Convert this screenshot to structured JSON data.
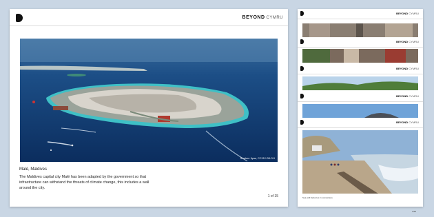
{
  "brand": {
    "name": "BEYOND",
    "region": "CYMRU"
  },
  "main": {
    "photo_credit": "Shahee Ilyas, CC BY-SA 3.0",
    "caption_title": "Malé, Maldives",
    "caption_body": "The Maldives capital city Malé has been adapted by the government so that infrastructure can withstand the threats of climate change, this includes a wall around the city.",
    "page_indicator": "1 of 15"
  },
  "thumbnails": {
    "last_caption": "Sea wall defences in somewhere",
    "last_page": "2/15"
  }
}
